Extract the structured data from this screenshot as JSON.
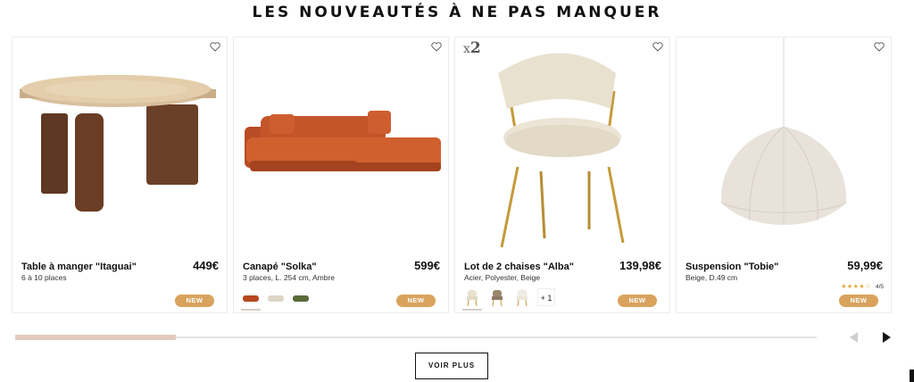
{
  "section": {
    "title": "LES NOUVEAUTÉS À NE PAS MANQUER"
  },
  "products": [
    {
      "name": "Table à manger \"Itaguai\"",
      "description": "6 à 10 places",
      "price": "449€",
      "badge": "NEW"
    },
    {
      "name": "Canapé \"Solka\"",
      "description": "3 places, L. 254 cm, Ambre",
      "price": "599€",
      "badge": "NEW",
      "swatches": [
        "sofa-amber-swatch",
        "sofa-beige-swatch",
        "sofa-green-swatch"
      ]
    },
    {
      "quantity_prefix": "x",
      "quantity": "2",
      "name": "Lot de 2 chaises \"Alba\"",
      "description": "Acier, Polyester, Beige",
      "price": "139,98€",
      "badge": "NEW",
      "swatches": [
        "chair-beige-swatch",
        "chair-taupe-swatch",
        "chair-white-swatch"
      ],
      "more_colors": "+ 1"
    },
    {
      "name": "Suspension \"Tobie\"",
      "description": "Beige, D.49 cm",
      "price": "59,99€",
      "badge": "NEW",
      "rating": {
        "stars": "★★★★☆",
        "text": "4/5"
      }
    }
  ],
  "carousel": {
    "progress": 0.2
  },
  "footer": {
    "see_more_label": "VOIR PLUS"
  },
  "colors": {
    "badge": "#d9a35e",
    "progress_fill": "#e2cabc",
    "sofa": "#c4552b",
    "wood": "#6b4028"
  }
}
